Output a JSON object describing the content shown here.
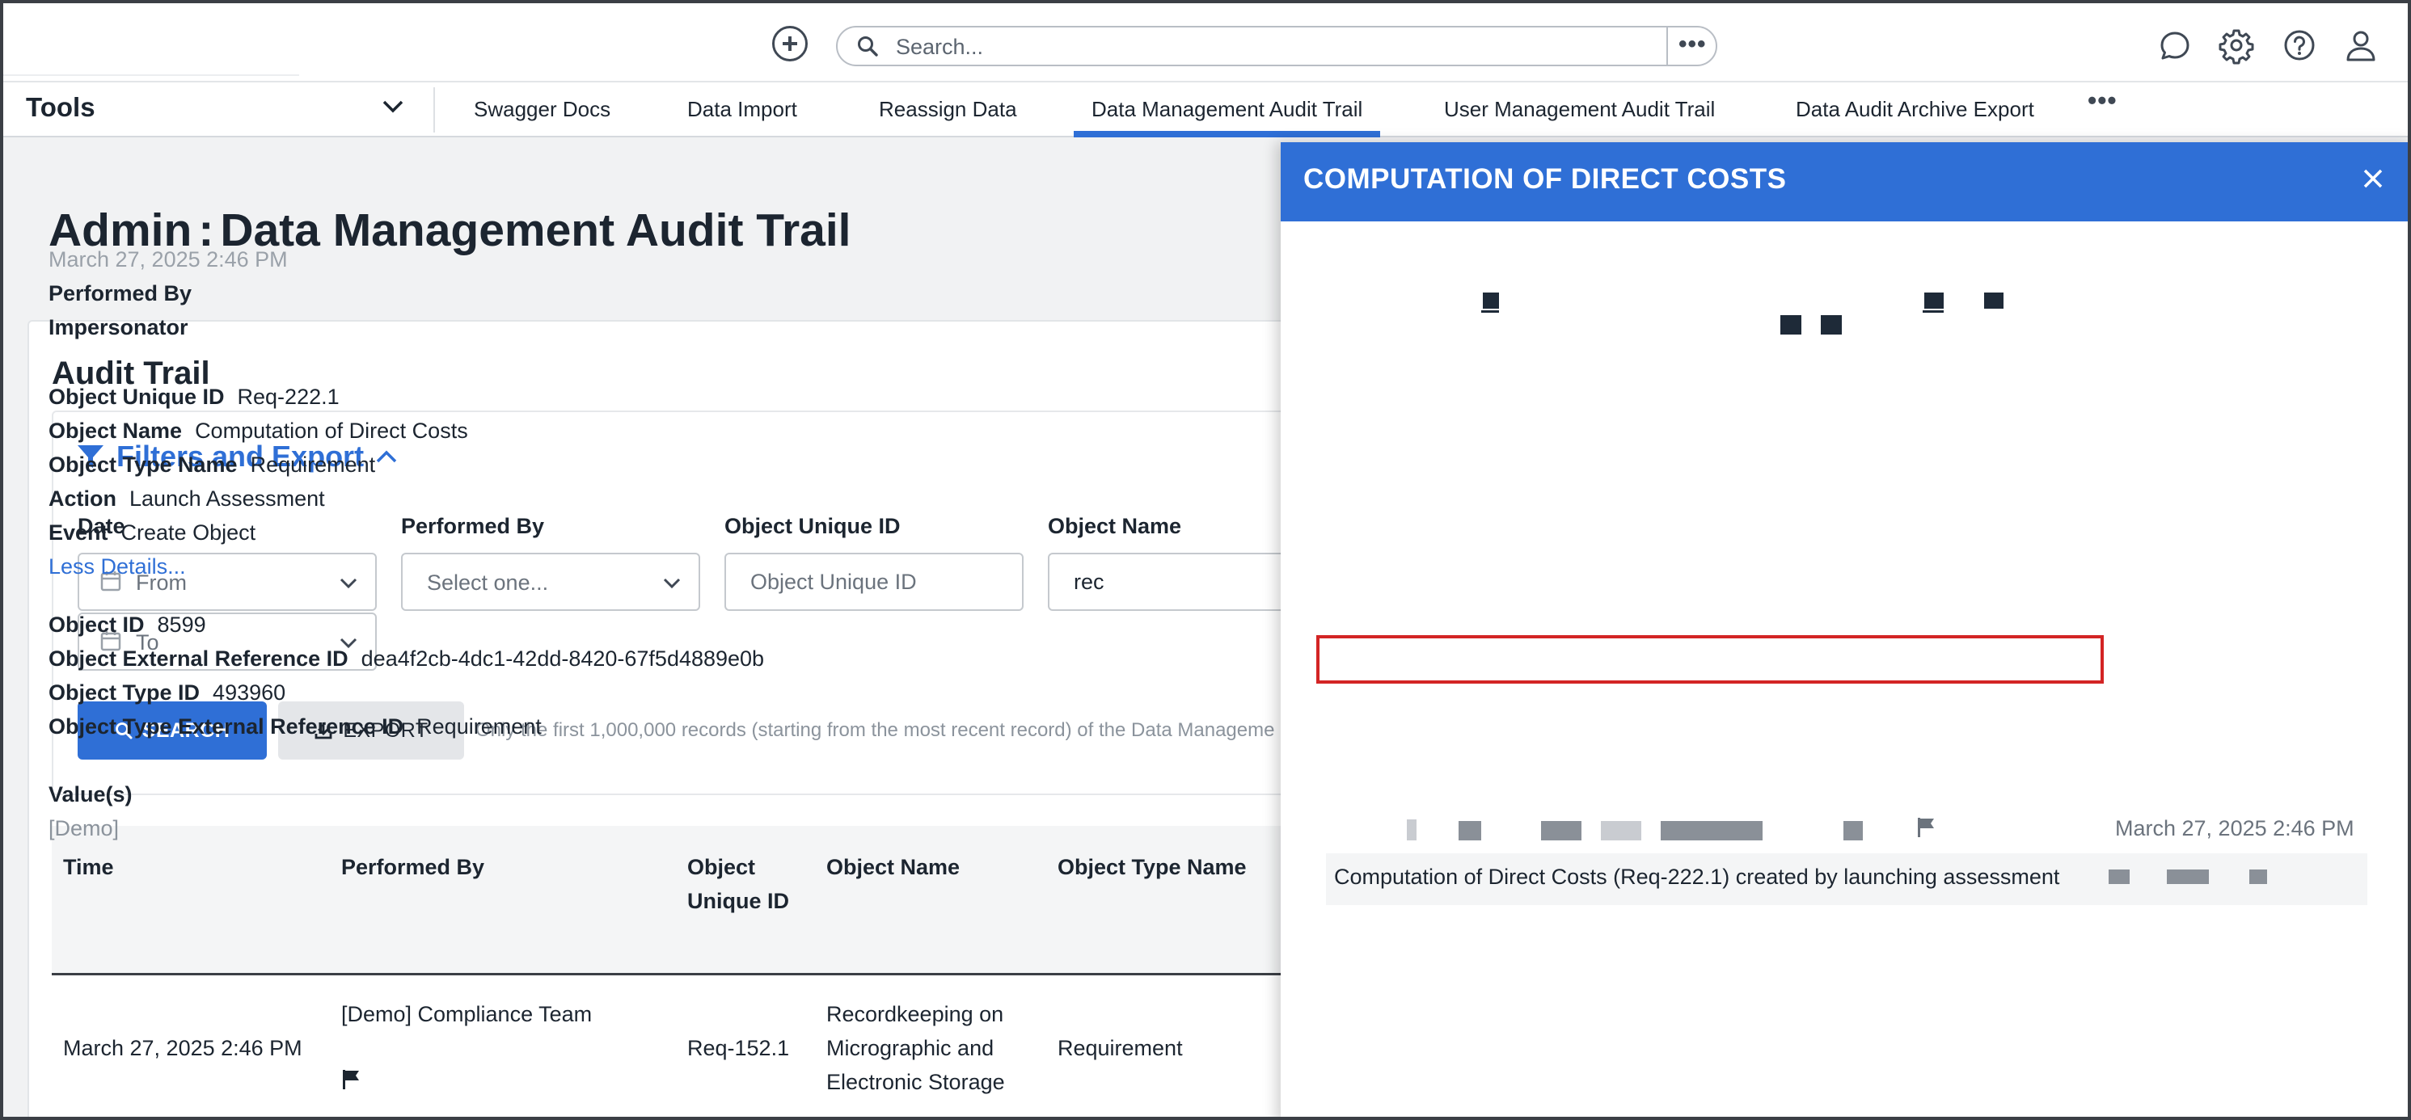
{
  "topbar": {
    "search_placeholder": "Search...",
    "search_more": "•••",
    "icons": [
      "add-icon",
      "search-icon",
      "chat-icon",
      "gear-icon",
      "help-icon",
      "user-icon"
    ]
  },
  "tabbar": {
    "menu_label": "Tools",
    "tabs": [
      {
        "label": "Swagger Docs"
      },
      {
        "label": "Data Import"
      },
      {
        "label": "Reassign Data"
      },
      {
        "label": "Data Management Audit Trail",
        "active": true
      },
      {
        "label": "User Management Audit Trail"
      },
      {
        "label": "Data Audit Archive Export"
      }
    ],
    "more": "•••"
  },
  "page": {
    "title_prefix": "Admin",
    "title_colon": ":",
    "title_main": "Data Management Audit Trail",
    "card_title": "Audit Trail",
    "filters_title": "Filters and Export",
    "filters": {
      "date_label": "Date",
      "from_text": "From",
      "to_text": "To",
      "performed_by_label": "Performed By",
      "performed_by_placeholder": "Select one...",
      "unique_id_label": "Object Unique ID",
      "unique_id_placeholder": "Object Unique ID",
      "object_name_label": "Object Name",
      "object_name_value": "rec"
    },
    "search_button": "SEARCH",
    "export_button": "EXPORT",
    "note": "Only the first 1,000,000 records (starting from the most recent record) of the Data Manageme"
  },
  "table": {
    "headers": [
      "Time",
      "Performed By",
      "Object",
      "Unique ID",
      "Object Name",
      "Object Type Name"
    ],
    "rows": [
      {
        "time": "March 27, 2025 2:46 PM",
        "performed_by": "[Demo] Compliance Team",
        "unique_id": "Req-152.1",
        "name_l1": "Recordkeeping on",
        "name_l2": "Micrographic and",
        "name_l3": "Electronic Storage",
        "type": "Requirement"
      }
    ]
  },
  "panel": {
    "title": "COMPUTATION OF DIRECT COSTS",
    "date": "March 27, 2025 2:46 PM",
    "performed_by_label": "Performed By",
    "impersonator_label": "Impersonator",
    "unique_id_label": "Object Unique ID",
    "unique_id": "Req-222.1",
    "name_label": "Object Name",
    "name": "Computation of Direct Costs",
    "type_name_label": "Object Type Name",
    "type_name": "Requirement",
    "action_label": "Action",
    "action": "Launch Assessment",
    "event_label": "Event",
    "event": "Create Object",
    "less_details": "Less Details...",
    "object_id_label": "Object ID",
    "object_id": "8599",
    "ext_ref_label": "Object External Reference ID",
    "ext_ref": "dea4f2cb-4dc1-42dd-8420-67f5d4889e0b",
    "type_id_label": "Object Type ID",
    "type_id": "493960",
    "type_ext_ref_label": "Object Type External Reference ID",
    "type_ext_ref": "Requirement",
    "values_label": "Value(s)",
    "value_author": "[Demo]",
    "value_date": "March 27, 2025 2:46 PM",
    "value_text": "Computation of Direct Costs (Req-222.1) created by launching assessment"
  },
  "colors": {
    "accent": "#2f6fd6",
    "highlight": "#d32424",
    "text": "#1c2530"
  }
}
